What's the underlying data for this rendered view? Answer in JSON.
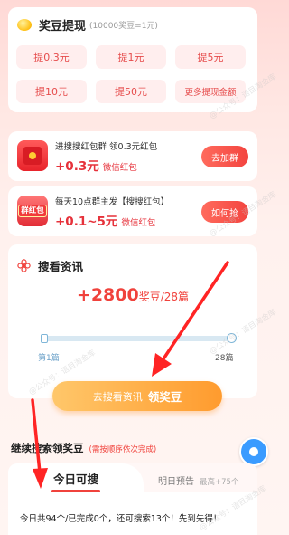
{
  "withdraw": {
    "title": "奖豆提现",
    "rate": "(10000奖豆=1元)",
    "options": [
      {
        "label": "提0.3元"
      },
      {
        "label": "提1元"
      },
      {
        "label": "提5元"
      },
      {
        "label": "提10元"
      },
      {
        "label": "提50元"
      },
      {
        "label": "更多提现金额"
      }
    ]
  },
  "tasks": [
    {
      "title": "进搜搜红包群 领0.3元红包",
      "amount": "+0.3元",
      "unit": "微信红包",
      "button": "去加群",
      "icon": "red-packet-icon"
    },
    {
      "title": "每天10点群主发【搜搜红包】",
      "amount": "+0.1~5元",
      "unit": "微信红包",
      "button": "如何抢",
      "icon_tag": "群红包",
      "icon": "group-red-packet-icon"
    }
  ],
  "search": {
    "title": "搜看资讯",
    "reward": "+2800",
    "reward_suffix": "奖豆/28篇",
    "progress_start": "第1篇",
    "progress_end": "28篇",
    "progress_value": 0,
    "button_main": "去搜看资讯",
    "button_reward": "领奖豆"
  },
  "continue": {
    "title": "继续搜索领奖豆",
    "subtitle": "(需按顺序依次完成)"
  },
  "tabs": {
    "today": "今日可搜",
    "tomorrow": "明日预告",
    "tomorrow_sub": "最高+75个"
  },
  "stats": {
    "text": "今日共94个/已完成0个，还可搜索13个！先到先得！"
  },
  "watermark": "@公众号：语目淘金库",
  "colors": {
    "accent": "#f0423c",
    "orange": "#ff9b2e",
    "progress": "#7fb6d8"
  }
}
